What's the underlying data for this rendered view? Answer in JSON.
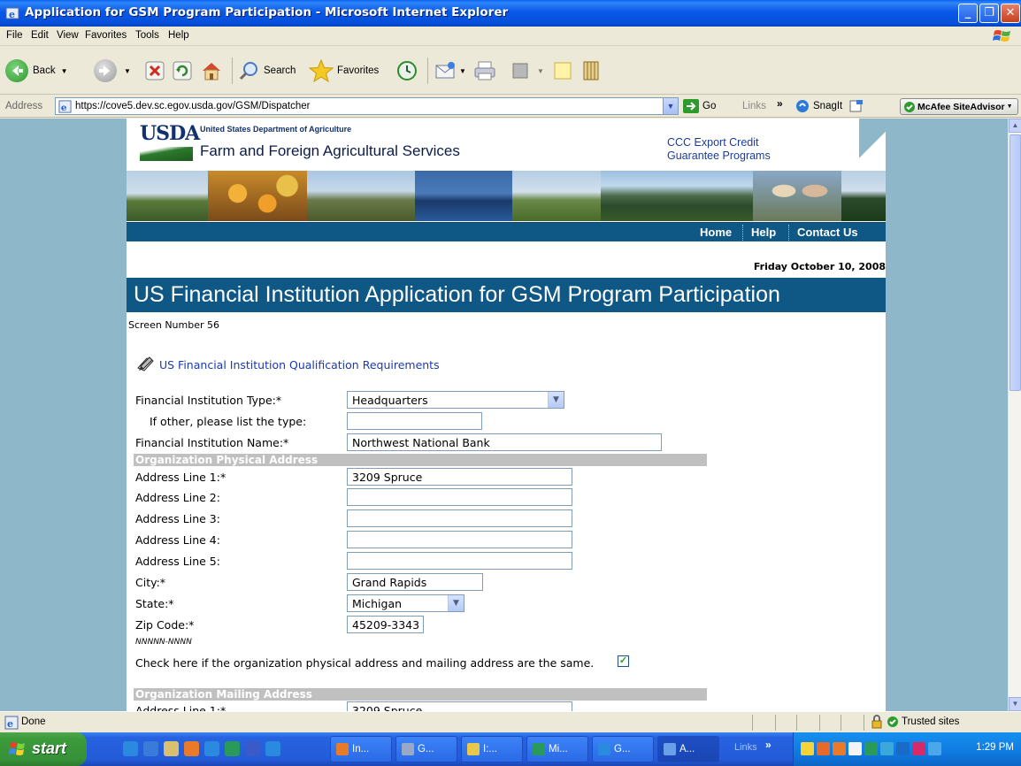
{
  "window": {
    "title": "Application for GSM Program Participation - Microsoft Internet Explorer"
  },
  "menu": [
    "File",
    "Edit",
    "View",
    "Favorites",
    "Tools",
    "Help"
  ],
  "toolbar": {
    "back": "Back",
    "search": "Search",
    "favorites": "Favorites"
  },
  "address": {
    "label": "Address",
    "url": "https://cove5.dev.sc.egov.usda.gov/GSM/Dispatcher",
    "go": "Go",
    "links": "Links",
    "snagit": "SnagIt",
    "mcafee": "McAfee SiteAdvisor"
  },
  "header": {
    "logo": "USDA",
    "department": "United States Department of Agriculture",
    "agency": "Farm and Foreign Agricultural Services",
    "ccc_line1": "CCC Export Credit",
    "ccc_line2": "Guarantee Programs"
  },
  "nav": {
    "home": "Home",
    "help": "Help",
    "contact": "Contact Us"
  },
  "page": {
    "date": "Friday October 10, 2008",
    "title": "US Financial Institution Application for GSM Program Participation",
    "screen_number": "Screen Number 56",
    "qualification_link": "US Financial Institution Qualification Requirements"
  },
  "form": {
    "type_label": "Financial Institution Type:*",
    "type_value": "Headquarters",
    "other_label": "If other, please list the type:",
    "other_value": "",
    "name_label": "Financial Institution Name:*",
    "name_value": "Northwest National Bank",
    "physical_section": "Organization Physical Address",
    "addr1_label": "Address Line 1:*",
    "addr1_value": "3209 Spruce",
    "addr2_label": "Address Line 2:",
    "addr3_label": "Address Line 3:",
    "addr4_label": "Address Line 4:",
    "addr5_label": "Address Line 5:",
    "city_label": "City:*",
    "city_value": "Grand Rapids",
    "state_label": "State:*",
    "state_value": "Michigan",
    "zip_label": "Zip Code:*",
    "zip_value": "45209-3343",
    "zip_hint": "NNNNN-NNNN",
    "same_label": "Check here if the organization physical address and mailing address are the same.",
    "same_checked": true,
    "mailing_section": "Organization Mailing Address",
    "mail_addr1_label": "Address Line 1:*",
    "mail_addr1_value": "3209 Spruce"
  },
  "status": {
    "text": "Done",
    "zone": "Trusted sites"
  },
  "taskbar": {
    "start": "start",
    "tasks": [
      "In...",
      "G...",
      "I:...",
      "Mi...",
      "G...",
      "A..."
    ],
    "links": "Links",
    "clock": "1:29 PM"
  }
}
